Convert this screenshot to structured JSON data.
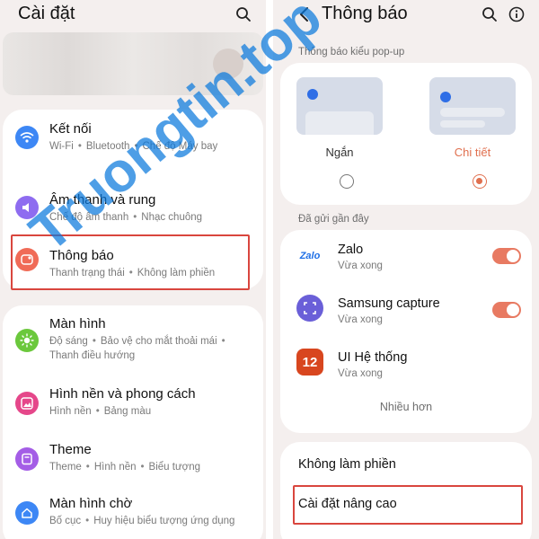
{
  "left": {
    "title": "Cài đặt",
    "items": [
      {
        "title": "Kết nối",
        "subs": [
          "Wi-Fi",
          "Bluetooth",
          "Chế độ Máy bay"
        ],
        "icon": "wifi-icon",
        "color": "#3d87f5"
      },
      {
        "title": "Âm thanh và rung",
        "subs": [
          "Chế độ âm thanh",
          "Nhạc chuông"
        ],
        "icon": "speaker-icon",
        "color": "#8e6cf0"
      },
      {
        "title": "Thông báo",
        "subs": [
          "Thanh trạng thái",
          "Không làm phiền"
        ],
        "icon": "notification-icon",
        "color": "#f06b57"
      },
      {
        "title": "Màn hình",
        "subs_line1": [
          "Độ sáng",
          "Bảo vệ cho mắt thoải mái"
        ],
        "subs_line2": "Thanh điều hướng",
        "icon": "sun-icon",
        "color": "#6bc83c"
      },
      {
        "title": "Hình nền và phong cách",
        "subs": [
          "Hình nền",
          "Bảng màu"
        ],
        "icon": "image-icon",
        "color": "#e5478a"
      },
      {
        "title": "Theme",
        "subs": [
          "Theme",
          "Hình nền",
          "Biểu tượng"
        ],
        "icon": "theme-icon",
        "color": "#a45de6"
      },
      {
        "title": "Màn hình chờ",
        "subs": [
          "Bố cục",
          "Huy hiệu biểu tượng ứng dụng"
        ],
        "icon": "home-icon",
        "color": "#3d87f5"
      }
    ]
  },
  "right": {
    "title": "Thông báo",
    "popup_section": "Thông báo kiểu pop-up",
    "popup_options": [
      {
        "label": "Ngắn",
        "selected": false
      },
      {
        "label": "Chi tiết",
        "selected": true
      }
    ],
    "recent_section": "Đã gửi gần đây",
    "apps": [
      {
        "name": "Zalo",
        "time": "Vừa xong",
        "enabled": true,
        "icon_text": "Zalo"
      },
      {
        "name": "Samsung capture",
        "time": "Vừa xong",
        "enabled": true,
        "icon_text": ""
      },
      {
        "name": "UI Hệ thống",
        "time": "Vừa xong",
        "enabled": null,
        "icon_text": "12"
      }
    ],
    "more": "Nhiều hơn",
    "dnd": "Không làm phiền",
    "advanced": "Cài đặt nâng cao"
  },
  "watermark": "Truongtin.top",
  "colors": {
    "accent": "#e0704f",
    "highlight": "#d9463e",
    "toggle": "#e87a62"
  }
}
